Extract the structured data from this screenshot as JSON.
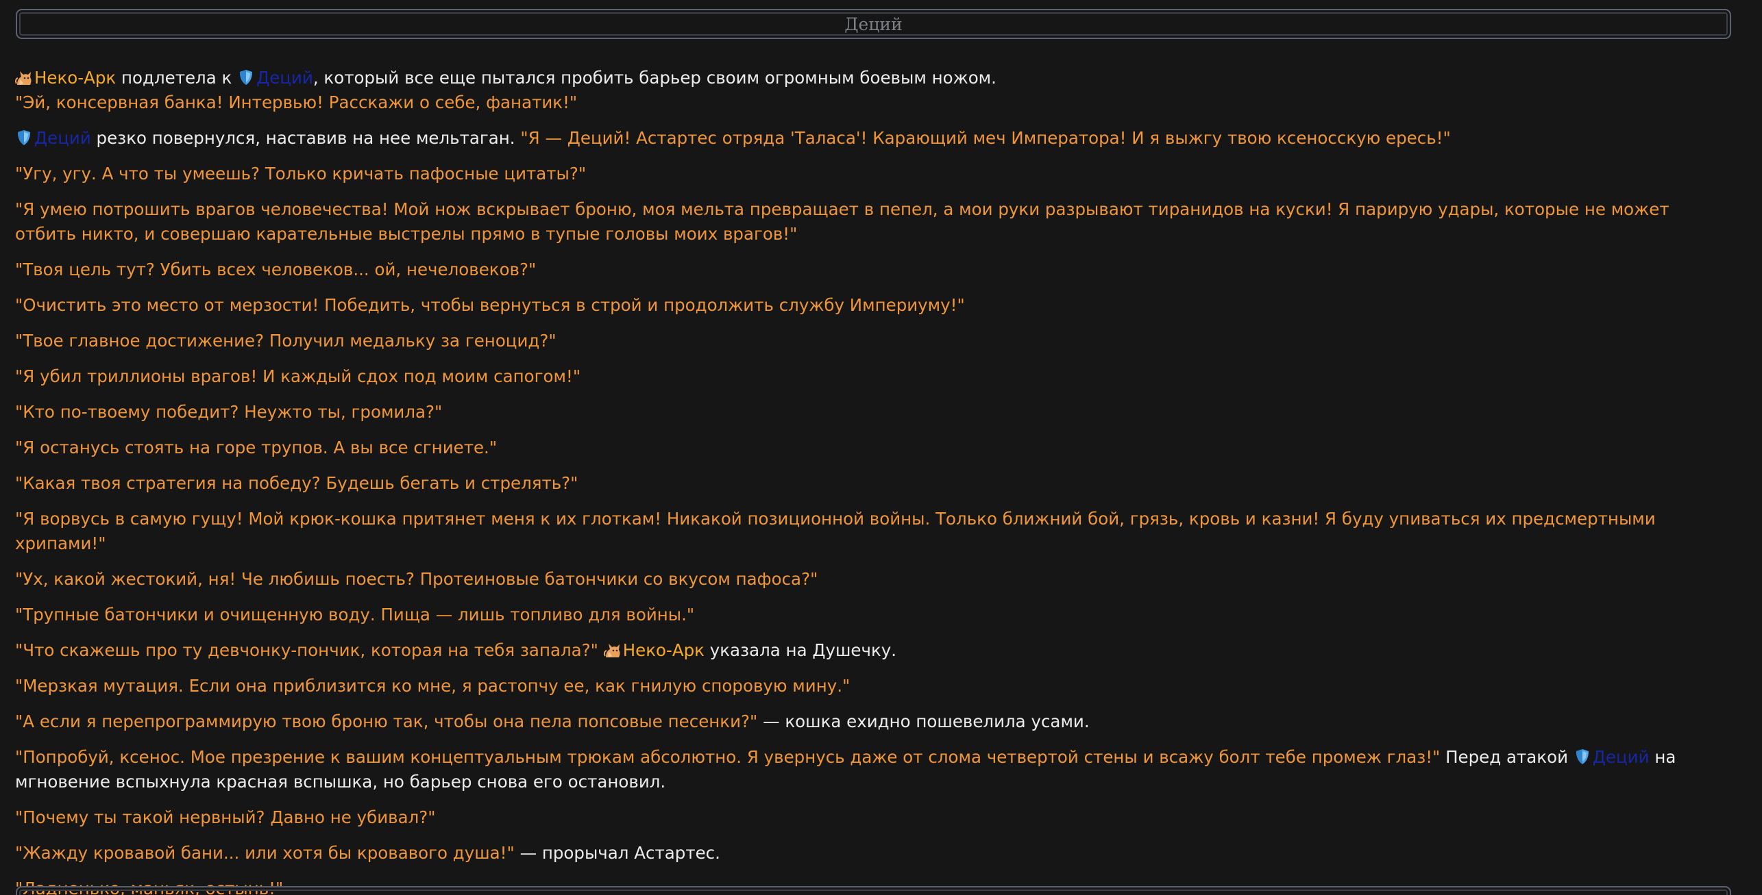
{
  "header": {
    "title": "Деций"
  },
  "names": {
    "neko": "Неко-Арк",
    "decius": "Деций"
  },
  "icons": {
    "neko": "cat-icon",
    "decius": "shield-icon"
  },
  "colors": {
    "quote": "#f0963a",
    "neko": "#f7a928",
    "decius": "#1627a6",
    "narration": "#ececec",
    "background": "#161616"
  },
  "messages": [
    [
      {
        "k": "icon",
        "icon": "neko"
      },
      {
        "k": "neko",
        "text": "Неко-Арк"
      },
      {
        "k": "t",
        "text": " подлетела к "
      },
      {
        "k": "icon",
        "icon": "decius"
      },
      {
        "k": "dec",
        "text": "Деций"
      },
      {
        "k": "t",
        "text": ", который все еще пытался пробить барьер своим огромным боевым ножом."
      }
    ],
    [
      {
        "k": "q",
        "text": "\"Эй, консервная банка! Интервью! Расскажи о себе, фанатик!\""
      }
    ],
    [
      {
        "k": "icon",
        "icon": "decius"
      },
      {
        "k": "dec",
        "text": "Деций"
      },
      {
        "k": "t",
        "text": " резко повернулся, наставив на нее мельтаган. "
      },
      {
        "k": "q",
        "text": "\"Я — Деций! Астартес отряда 'Таласа'! Карающий меч Императора! И я выжгу твою ксеносскую ересь!\""
      }
    ],
    [
      {
        "k": "q",
        "text": "\"Угу, угу. А что ты умеешь? Только кричать пафосные цитаты?\""
      }
    ],
    [
      {
        "k": "q",
        "text": "\"Я умею потрошить врагов человечества! Мой нож вскрывает броню, моя мельта превращает в пепел, а мои руки разрывают тиранидов на куски! Я парирую удары, которые не может отбить никто, и совершаю карательные выстрелы прямо в тупые головы моих врагов!\""
      }
    ],
    [
      {
        "k": "q",
        "text": "\"Твоя цель тут? Убить всех человеков... ой, нечеловеков?\""
      }
    ],
    [
      {
        "k": "q",
        "text": "\"Очистить это место от мерзости! Победить, чтобы вернуться в строй и продолжить службу Империуму!\""
      }
    ],
    [
      {
        "k": "q",
        "text": "\"Твое главное достижение? Получил медальку за геноцид?\""
      }
    ],
    [
      {
        "k": "q",
        "text": "\"Я убил триллионы врагов! И каждый сдох под моим сапогом!\""
      }
    ],
    [
      {
        "k": "q",
        "text": "\"Кто по-твоему победит? Неужто ты, громила?\""
      }
    ],
    [
      {
        "k": "q",
        "text": "\"Я останусь стоять на горе трупов. А вы все сгниете.\""
      }
    ],
    [
      {
        "k": "q",
        "text": "\"Какая твоя стратегия на победу? Будешь бегать и стрелять?\""
      }
    ],
    [
      {
        "k": "q",
        "text": "\"Я ворвусь в самую гущу! Мой крюк-кошка притянет меня к их глоткам! Никакой позиционной войны. Только ближний бой, грязь, кровь и казни! Я буду упиваться их предсмертными хрипами!\""
      }
    ],
    [
      {
        "k": "q",
        "text": "\"Ух, какой жестокий, ня! Че любишь поесть? Протеиновые батончики со вкусом пафоса?\""
      }
    ],
    [
      {
        "k": "q",
        "text": "\"Трупные батончики и очищенную воду. Пища — лишь топливо для войны.\""
      }
    ],
    [
      {
        "k": "q",
        "text": "\"Что скажешь про ту девчонку-пончик, которая на тебя запала?\""
      },
      {
        "k": "t",
        "text": " "
      },
      {
        "k": "icon",
        "icon": "neko"
      },
      {
        "k": "neko",
        "text": "Неко-Арк"
      },
      {
        "k": "t",
        "text": " указала на Душечку."
      }
    ],
    [
      {
        "k": "q",
        "text": "\"Мерзкая мутация. Если она приблизится ко мне, я растопчу ее, как гнилую споровую мину.\""
      }
    ],
    [
      {
        "k": "q",
        "text": "\"А если я перепрограммирую твою броню так, чтобы она пела попсовые песенки?\""
      },
      {
        "k": "t",
        "text": " — кошка ехидно пошевелила усами."
      }
    ],
    [
      {
        "k": "q",
        "text": "\"Попробуй, ксенос. Мое презрение к вашим концептуальным трюкам абсолютно. Я увернусь даже от слома четвертой стены и всажу болт тебе промеж глаз!\""
      },
      {
        "k": "t",
        "text": " Перед атакой "
      },
      {
        "k": "icon",
        "icon": "decius"
      },
      {
        "k": "dec",
        "text": "Деций"
      },
      {
        "k": "t",
        "text": " на мгновение вспыхнула красная вспышка, но барьер снова его остановил."
      }
    ],
    [
      {
        "k": "q",
        "text": "\"Почему ты такой нервный? Давно не убивал?\""
      }
    ],
    [
      {
        "k": "q",
        "text": "\"Жажду кровавой бани... или хотя бы кровавого душа!\""
      },
      {
        "k": "t",
        "text": " — прорычал Астартес."
      }
    ],
    [
      {
        "k": "q",
        "text": "\"Ладненько, маньяк, остынь!\""
      }
    ]
  ]
}
